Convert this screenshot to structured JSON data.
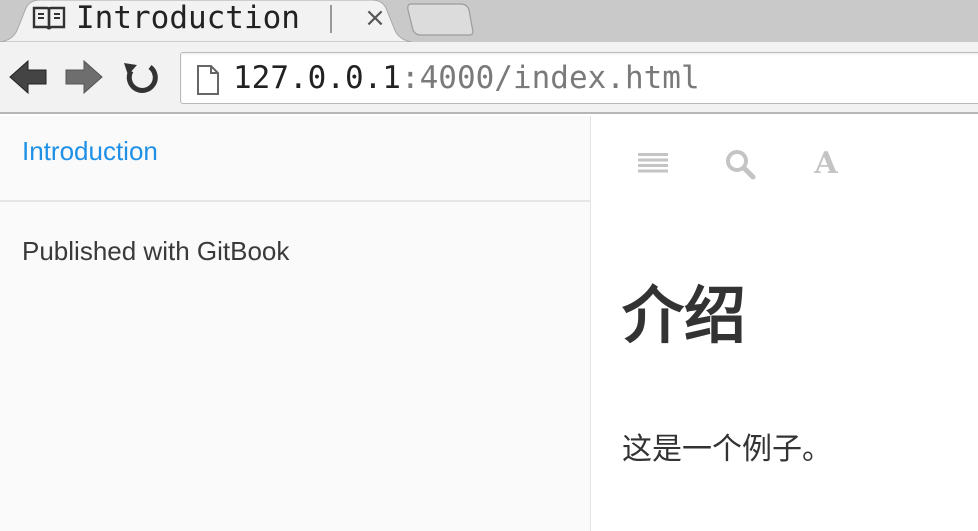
{
  "browser": {
    "tab": {
      "title": "Introduction",
      "icon": "gitbook-book-icon",
      "close_label": "×"
    },
    "nav": {
      "back_icon": "back-arrow-icon",
      "forward_icon": "forward-arrow-icon",
      "reload_icon": "reload-icon"
    },
    "address_bar": {
      "icon": "page-icon",
      "host": "127.0.0.1",
      "rest": ":4000/index.html"
    }
  },
  "sidebar": {
    "items": [
      {
        "label": "Introduction",
        "active": true
      }
    ],
    "footer_label": "Published with GitBook"
  },
  "toolbar": {
    "menu_icon": "hamburger-icon",
    "search_icon": "search-icon",
    "font_icon": "font-settings-icon",
    "font_glyph": "A"
  },
  "content": {
    "title": "介绍",
    "body": "这是一个例子。"
  },
  "colors": {
    "link": "#1e90e6",
    "text": "#333333",
    "toolbar_icon": "#c4c4c4",
    "sidebar_bg": "#fafafa"
  }
}
